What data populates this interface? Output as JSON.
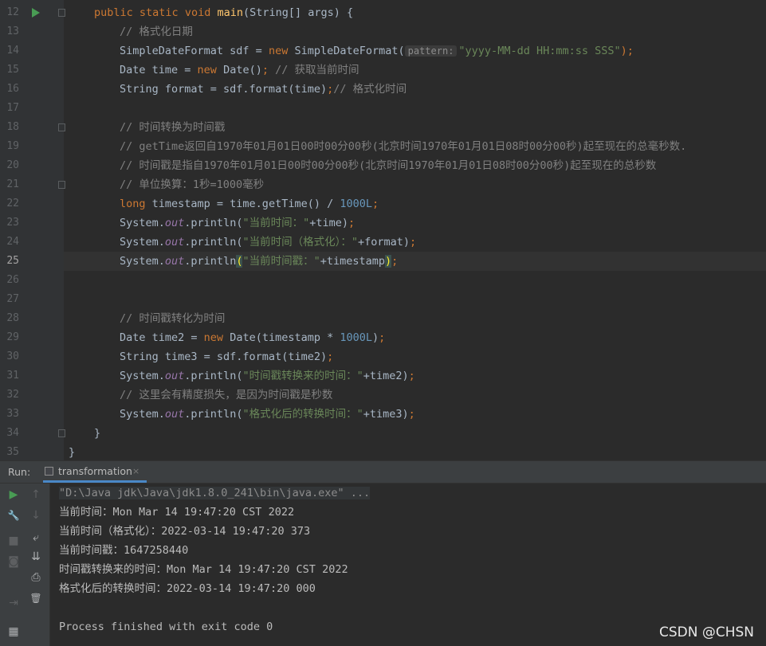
{
  "editor": {
    "line_numbers": [
      "12",
      "13",
      "14",
      "15",
      "16",
      "17",
      "18",
      "19",
      "20",
      "21",
      "22",
      "23",
      "24",
      "25",
      "26",
      "27",
      "28",
      "29",
      "30",
      "31",
      "32",
      "33",
      "34",
      "35"
    ],
    "current_line": "25",
    "code": {
      "l12_a": "public ",
      "l12_b": "static ",
      "l12_c": "void ",
      "l12_d": "main",
      "l12_e": "(String[] args) {",
      "l13": "// 格式化日期",
      "l14_a": "SimpleDateFormat sdf = ",
      "l14_b": "new ",
      "l14_c": "SimpleDateFormat(",
      "l14_hint": "pattern:",
      "l14_d": "\"yyyy-MM-dd HH:mm:ss SSS\"",
      "l14_e": ");",
      "l15_a": "Date time = ",
      "l15_b": "new ",
      "l15_c": "Date()",
      "l15_d": "; ",
      "l15_e": "// 获取当前时间",
      "l16_a": "String format = sdf.format(time)",
      "l16_b": ";",
      "l16_c": "// 格式化时间",
      "l18": "// 时间转换为时间戳",
      "l19": "// getTime返回自1970年01月01日00时00分00秒(北京时间1970年01月01日08时00分00秒)起至现在的总毫秒数.",
      "l20": "// 时间戳是指自1970年01月01日00时00分00秒(北京时间1970年01月01日08时00分00秒)起至现在的总秒数",
      "l21": "// 单位换算：1秒=1000毫秒",
      "l22_a": "long ",
      "l22_b": "timestamp = time.getTime() / ",
      "l22_c": "1000L",
      "l22_d": ";",
      "l23_a": "System.",
      "l23_b": "out",
      "l23_c": ".println(",
      "l23_d": "\"当前时间：\"",
      "l23_e": "+time)",
      "l23_f": ";",
      "l24_a": "System.",
      "l24_b": "out",
      "l24_c": ".println(",
      "l24_d": "\"当前时间（格式化）：\"",
      "l24_e": "+format)",
      "l24_f": ";",
      "l25_a": "System.",
      "l25_b": "out",
      "l25_c": ".println",
      "l25_d": "(",
      "l25_e": "\"当前时间戳：\"",
      "l25_f": "+timestamp",
      "l25_g": ")",
      "l25_h": ";",
      "l28": "// 时间戳转化为时间",
      "l29_a": "Date time2 = ",
      "l29_b": "new ",
      "l29_c": "Date(timestamp * ",
      "l29_d": "1000L",
      "l29_e": ")",
      "l29_f": ";",
      "l30_a": "String time3 = sdf.format(time2)",
      "l30_b": ";",
      "l31_a": "System.",
      "l31_b": "out",
      "l31_c": ".println(",
      "l31_d": "\"时间戳转换来的时间：\"",
      "l31_e": "+time2)",
      "l31_f": ";",
      "l32": "// 这里会有精度损失，是因为时间戳是秒数",
      "l33_a": "System.",
      "l33_b": "out",
      "l33_c": ".println(",
      "l33_d": "\"格式化后的转换时间：\"",
      "l33_e": "+time3)",
      "l33_f": ";",
      "l34": "}",
      "l35": "}"
    }
  },
  "run_panel": {
    "label": "Run:",
    "tab_label": "transformation",
    "tab_close": "×",
    "console": [
      "\"D:\\Java jdk\\Java\\jdk1.8.0_241\\bin\\java.exe\" ...",
      "当前时间：Mon Mar 14 19:47:20 CST 2022",
      "当前时间（格式化）：2022-03-14 19:47:20 373",
      "当前时间戳：1647258440",
      "时间戳转换来的时间：Mon Mar 14 19:47:20 CST 2022",
      "格式化后的转换时间：2022-03-14 19:47:20 000",
      "",
      "Process finished with exit code 0"
    ],
    "toolbar_icons": {
      "rerun": "▶",
      "up": "↑",
      "wrench": "🔧",
      "down": "↓",
      "stop": "■",
      "soft_wrap": "⤶",
      "camera": "◙",
      "scroll_end": "⇊",
      "exit": "⇥",
      "print": "⎙",
      "trash": "🗑",
      "layout": "▦"
    }
  },
  "watermark": "CSDN @CHSN",
  "colors": {
    "background": "#2b2b2b",
    "keyword": "#cc7832",
    "method": "#ffc66d",
    "string": "#6a8759",
    "number": "#6897bb",
    "comment": "#808080",
    "static_field": "#9876aa",
    "text": "#a9b7c6"
  }
}
